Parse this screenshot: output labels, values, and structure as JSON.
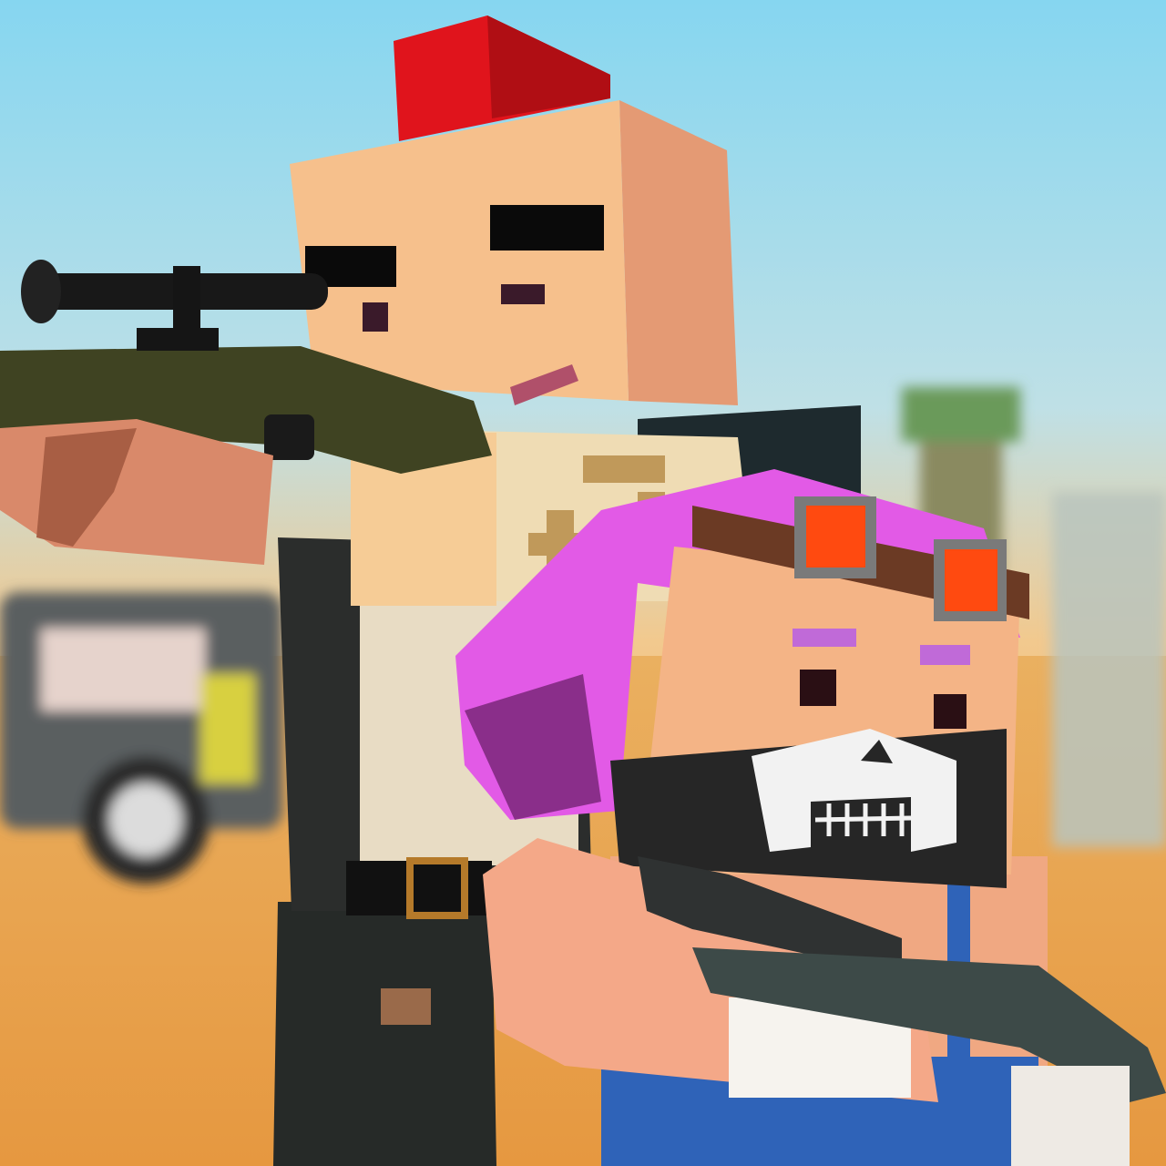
{
  "scene": {
    "type": "game-key-art",
    "characters": [
      "sniper-character",
      "skull-mask-character"
    ]
  },
  "colors": {
    "sky_top": "#86d6f0",
    "sky_horizon": "#f2c98e",
    "ground": "#eaa24a",
    "skin": "#f4b486",
    "skin_shadow": "#d98f6a",
    "hair_red": "#e0141c",
    "hair_pink": "#e25ae6",
    "shirt": "#efdcb4",
    "vest": "#2b2d2c",
    "rifle": "#3f4322",
    "mask": "#262626",
    "skull": "#f2f2f2",
    "goggle_lens": "#ff4a10",
    "overalls": "#2f63b8"
  }
}
